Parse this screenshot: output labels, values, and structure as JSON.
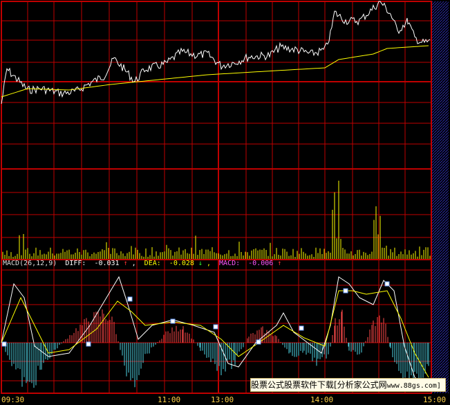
{
  "macd_header": {
    "label": "MACD(26,12,9)",
    "diff_label": "DIFF:",
    "diff_value": "-0.031",
    "diff_arrow": "↑",
    "dea_label": "DEA:",
    "dea_value": "-0.028",
    "dea_arrow": "↓",
    "macd_label": "MACD:",
    "macd_value": "-0.006",
    "macd_arrow": "↑"
  },
  "watermark": {
    "text": "股票公式股票软件下载[分析家公式网",
    "site": "www.88gs.com]"
  },
  "time_axis": {
    "labels": [
      "09:30",
      "11:00",
      "13:00",
      "14:00",
      "15:00"
    ]
  },
  "colors": {
    "background": "#000000",
    "grid": "#c00000",
    "price_line": "#ffffff",
    "avg_line": "#ffff00",
    "volume": "#ffff00",
    "macd_positive": "#ff4a4a",
    "macd_negative": "#4fd6e6",
    "hatch": "#2a2aa8"
  }
}
